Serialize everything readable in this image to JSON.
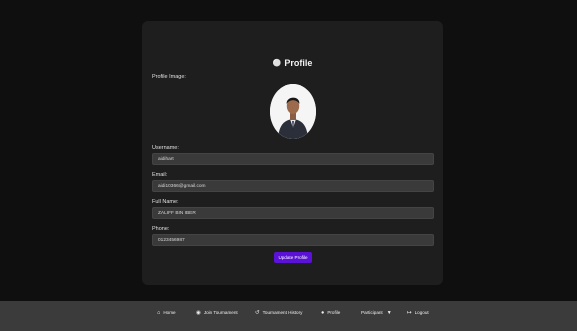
{
  "profile": {
    "title": "Profile",
    "title_icon": "user-circle-icon",
    "image_label": "Profile Image:",
    "username_label": "Username:",
    "username_value": "aidihart",
    "email_label": "Email:",
    "email_value": "aidi10366@gmail.com",
    "fullname_label": "Full Name:",
    "fullname_value": "ZALIFF BIN IBER",
    "phone_label": "Phone:",
    "phone_value": "0123456987",
    "update_button": "Update Profile"
  },
  "footer": {
    "home": "Home",
    "join": "Join Tournament",
    "history": "Tournament History",
    "profile": "Profile",
    "participant": "Participant",
    "logout": "Logout"
  },
  "colors": {
    "accent": "#5a12d6",
    "background": "#0f0f0f",
    "card": "#1e1e1e",
    "footer": "#3b3b3b"
  }
}
